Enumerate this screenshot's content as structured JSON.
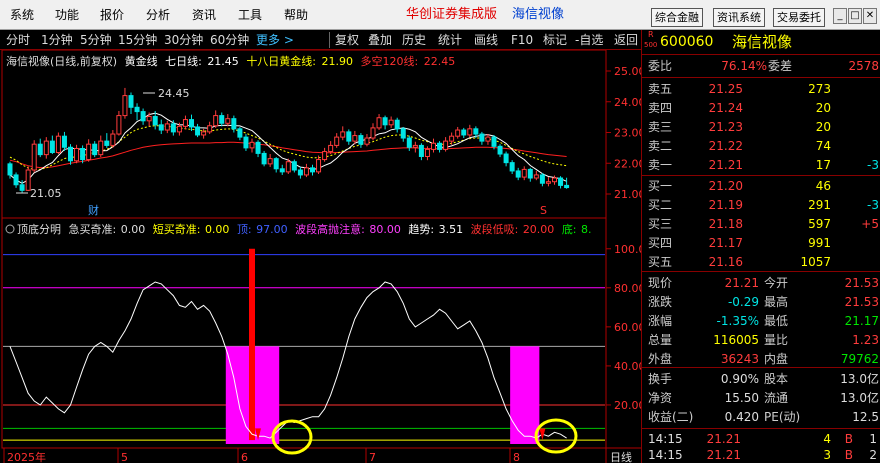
{
  "menu": [
    "系统",
    "功能",
    "报价",
    "分析",
    "资讯",
    "工具",
    "帮助"
  ],
  "brand": {
    "app": "华创证券集成版",
    "stock": "海信视像"
  },
  "top_buttons": [
    "综合金融",
    "资讯系统",
    "交易委托"
  ],
  "window_controls": [
    "_",
    "□",
    "✕"
  ],
  "toolbar_left": [
    "分时",
    "1分钟",
    "5分钟",
    "15分钟",
    "30分钟",
    "60分钟",
    "更多 >"
  ],
  "toolbar_right": [
    "复权",
    "叠加",
    "历史",
    "统计",
    "画线",
    "F10",
    "标记",
    "-自选",
    "返回"
  ],
  "main_legend": {
    "title": "海信视像(日线,前复权)",
    "ma1_label": "黄金线",
    "ma2_label": "七日线:",
    "ma2_val": "21.45",
    "ma3_label": "十八日黄金线:",
    "ma3_val": "21.90",
    "ma4_label": "多空120线:",
    "ma4_val": "22.45"
  },
  "sub_legend": {
    "name": "顶底分明",
    "f1_label": "急买奇准:",
    "f1_val": "0.00",
    "f2_label": "短买奇准:",
    "f2_val": "0.00",
    "f3_label": "顶:",
    "f3_val": "97.00",
    "f4_label": "波段高抛注意:",
    "f4_val": "80.00",
    "f5_label": "趋势:",
    "f5_val": "3.51",
    "f6_label": "波段低吸:",
    "f6_val": "20.00",
    "f7_label": "底:",
    "f7_val": "8."
  },
  "annotations": {
    "high": "24.45",
    "low": "21.05",
    "cai": "财",
    "s_mark": "S"
  },
  "main_axis": [
    "25.00",
    "24.00",
    "23.00",
    "22.00",
    "21.00"
  ],
  "sub_axis": [
    "100.0",
    "80.00",
    "60.00",
    "40.00",
    "20.00"
  ],
  "date_axis": [
    "2025年",
    "5",
    "6",
    "7",
    "8"
  ],
  "period": "日线",
  "chart_data": {
    "type": "candlestick",
    "price_axis": {
      "ylim": [
        20.5,
        25.2
      ],
      "ticks": [
        25,
        24,
        23,
        22,
        21
      ]
    },
    "candles": [
      [
        21.98,
        21.62,
        22.05,
        21.5
      ],
      [
        21.62,
        21.3,
        21.7,
        21.2
      ],
      [
        21.3,
        21.12,
        21.45,
        21.05
      ],
      [
        21.12,
        21.78,
        21.9,
        21.1
      ],
      [
        21.78,
        22.62,
        22.75,
        21.7
      ],
      [
        22.62,
        22.28,
        22.8,
        22.2
      ],
      [
        22.28,
        22.72,
        22.85,
        22.15
      ],
      [
        22.72,
        22.35,
        22.9,
        22.3
      ],
      [
        22.35,
        22.88,
        23.0,
        22.3
      ],
      [
        22.88,
        22.52,
        23.02,
        22.4
      ],
      [
        22.52,
        22.08,
        22.62,
        21.95
      ],
      [
        22.08,
        22.48,
        22.6,
        22.0
      ],
      [
        22.48,
        22.12,
        22.58,
        22.0
      ],
      [
        22.12,
        22.62,
        22.78,
        22.05
      ],
      [
        22.62,
        22.28,
        22.72,
        22.2
      ],
      [
        22.28,
        22.72,
        22.9,
        22.2
      ],
      [
        22.72,
        22.58,
        22.98,
        22.5
      ],
      [
        22.58,
        22.95,
        23.08,
        22.5
      ],
      [
        22.95,
        23.55,
        23.7,
        22.9
      ],
      [
        23.55,
        24.2,
        24.45,
        23.45
      ],
      [
        24.2,
        23.82,
        24.3,
        23.6
      ],
      [
        23.82,
        23.68,
        23.95,
        23.4
      ],
      [
        23.68,
        23.38,
        23.78,
        23.25
      ],
      [
        23.38,
        23.52,
        23.65,
        23.2
      ],
      [
        23.52,
        23.25,
        23.7,
        23.1
      ],
      [
        23.25,
        23.08,
        23.42,
        22.95
      ],
      [
        23.08,
        23.28,
        23.38,
        22.98
      ],
      [
        23.28,
        23.02,
        23.4,
        22.9
      ],
      [
        23.02,
        23.2,
        23.32,
        22.9
      ],
      [
        23.2,
        23.42,
        23.55,
        23.1
      ],
      [
        23.42,
        23.18,
        23.58,
        23.05
      ],
      [
        23.18,
        22.92,
        23.28,
        22.85
      ],
      [
        22.92,
        23.02,
        23.12,
        22.8
      ],
      [
        23.02,
        23.22,
        23.35,
        22.95
      ],
      [
        23.22,
        23.55,
        23.72,
        23.15
      ],
      [
        23.55,
        23.3,
        23.65,
        23.2
      ],
      [
        23.3,
        23.45,
        23.6,
        23.2
      ],
      [
        23.45,
        23.12,
        23.55,
        23.0
      ],
      [
        23.12,
        22.85,
        23.18,
        22.75
      ],
      [
        22.85,
        22.5,
        22.95,
        22.4
      ],
      [
        22.5,
        22.68,
        22.8,
        22.35
      ],
      [
        22.68,
        22.32,
        22.75,
        22.2
      ],
      [
        22.32,
        21.98,
        22.4,
        21.9
      ],
      [
        21.98,
        22.15,
        22.3,
        21.88
      ],
      [
        22.15,
        21.82,
        22.2,
        21.7
      ],
      [
        21.82,
        21.72,
        21.95,
        21.62
      ],
      [
        21.72,
        22.05,
        22.15,
        21.65
      ],
      [
        22.05,
        21.78,
        22.12,
        21.7
      ],
      [
        21.78,
        21.62,
        21.88,
        21.5
      ],
      [
        21.62,
        21.85,
        21.98,
        21.55
      ],
      [
        21.85,
        21.72,
        21.95,
        21.6
      ],
      [
        21.72,
        22.12,
        22.25,
        21.65
      ],
      [
        22.12,
        22.38,
        22.5,
        22.05
      ],
      [
        22.38,
        22.58,
        22.72,
        22.3
      ],
      [
        22.58,
        22.85,
        22.98,
        22.5
      ],
      [
        22.85,
        23.02,
        23.2,
        22.75
      ],
      [
        23.02,
        22.72,
        23.1,
        22.6
      ],
      [
        22.72,
        22.9,
        23.05,
        22.62
      ],
      [
        22.9,
        22.62,
        22.98,
        22.5
      ],
      [
        22.62,
        22.82,
        22.95,
        22.55
      ],
      [
        22.82,
        23.15,
        23.3,
        22.75
      ],
      [
        23.15,
        23.48,
        23.6,
        23.08
      ],
      [
        23.48,
        23.25,
        23.55,
        23.1
      ],
      [
        23.25,
        23.4,
        23.52,
        23.15
      ],
      [
        23.4,
        23.12,
        23.48,
        23.0
      ],
      [
        23.12,
        22.82,
        23.18,
        22.7
      ],
      [
        22.82,
        22.52,
        22.9,
        22.4
      ],
      [
        22.52,
        22.58,
        22.7,
        22.35
      ],
      [
        22.58,
        22.22,
        22.65,
        22.1
      ],
      [
        22.22,
        22.45,
        22.55,
        22.1
      ],
      [
        22.45,
        22.65,
        22.8,
        22.35
      ],
      [
        22.65,
        22.45,
        22.72,
        22.35
      ],
      [
        22.45,
        22.72,
        22.85,
        22.38
      ],
      [
        22.72,
        22.88,
        23.0,
        22.6
      ],
      [
        22.88,
        23.08,
        23.18,
        22.8
      ],
      [
        23.08,
        22.92,
        23.15,
        22.82
      ],
      [
        22.92,
        23.12,
        23.25,
        22.85
      ],
      [
        23.12,
        22.95,
        23.2,
        22.82
      ],
      [
        22.95,
        22.72,
        23.02,
        22.6
      ],
      [
        22.72,
        22.85,
        22.95,
        22.6
      ],
      [
        22.85,
        22.55,
        22.92,
        22.45
      ],
      [
        22.55,
        22.3,
        22.62,
        22.2
      ],
      [
        22.3,
        22.02,
        22.38,
        21.9
      ],
      [
        22.02,
        21.75,
        22.1,
        21.65
      ],
      [
        21.75,
        21.55,
        21.85,
        21.45
      ],
      [
        21.55,
        21.8,
        21.9,
        21.45
      ],
      [
        21.8,
        21.52,
        21.85,
        21.4
      ],
      [
        21.52,
        21.62,
        21.75,
        21.45
      ],
      [
        21.62,
        21.35,
        21.68,
        21.25
      ],
      [
        21.35,
        21.4,
        21.55,
        21.25
      ],
      [
        21.4,
        21.52,
        21.6,
        21.3
      ],
      [
        21.52,
        21.28,
        21.58,
        21.18
      ],
      [
        21.28,
        21.21,
        21.53,
        21.17
      ]
    ],
    "ma_yellow": [
      22.2,
      22.1,
      21.95,
      21.85,
      21.8,
      21.8,
      21.85,
      21.95,
      22.05,
      22.15,
      22.2,
      22.2,
      22.25,
      22.3,
      22.35,
      22.4,
      22.45,
      22.55,
      22.7,
      22.85,
      23.0,
      23.1,
      23.15,
      23.2,
      23.22,
      23.22,
      23.2,
      23.18,
      23.15,
      23.12,
      23.1,
      23.08,
      23.05,
      23.05,
      23.08,
      23.1,
      23.12,
      23.1,
      23.05,
      22.98,
      22.9,
      22.82,
      22.72,
      22.62,
      22.52,
      22.42,
      22.35,
      22.3,
      22.25,
      22.2,
      22.18,
      22.18,
      22.2,
      22.25,
      22.32,
      22.4,
      22.48,
      22.55,
      22.6,
      22.65,
      22.7,
      22.78,
      22.85,
      22.9,
      22.92,
      22.92,
      22.88,
      22.82,
      22.75,
      22.7,
      22.65,
      22.62,
      22.62,
      22.65,
      22.7,
      22.75,
      22.8,
      22.82,
      22.82,
      22.8,
      22.75,
      22.68,
      22.58,
      22.48,
      22.38,
      22.3,
      22.22,
      22.15,
      22.08,
      22.02,
      21.98,
      21.95,
      21.92
    ],
    "ma_red": [
      22.1,
      22.05,
      21.98,
      21.92,
      21.88,
      21.86,
      21.86,
      21.88,
      21.92,
      21.96,
      22.0,
      22.03,
      22.06,
      22.1,
      22.13,
      22.17,
      22.2,
      22.24,
      22.3,
      22.36,
      22.42,
      22.47,
      22.52,
      22.55,
      22.58,
      22.6,
      22.62,
      22.63,
      22.64,
      22.65,
      22.66,
      22.66,
      22.66,
      22.66,
      22.67,
      22.67,
      22.68,
      22.68,
      22.67,
      22.66,
      22.64,
      22.62,
      22.6,
      22.57,
      22.54,
      22.5,
      22.47,
      22.44,
      22.41,
      22.38,
      22.36,
      22.35,
      22.34,
      22.34,
      22.35,
      22.36,
      22.37,
      22.38,
      22.39,
      22.4,
      22.42,
      22.44,
      22.46,
      22.48,
      22.49,
      22.5,
      22.5,
      22.5,
      22.49,
      22.48,
      22.47,
      22.47,
      22.47,
      22.48,
      22.49,
      22.5,
      22.51,
      22.52,
      22.52,
      22.52,
      22.51,
      22.5,
      22.48,
      22.46,
      22.43,
      22.4,
      22.37,
      22.34,
      22.31,
      22.28,
      22.26,
      22.24,
      22.22
    ],
    "indicator_axis": {
      "ylim": [
        0,
        105
      ],
      "ticks": [
        100,
        80,
        60,
        40,
        20
      ]
    },
    "indicator_levels": {
      "top": 97,
      "high": 80,
      "mid": 50,
      "low": 20,
      "bottom": 8
    },
    "indicator_line": [
      50,
      42,
      34,
      26,
      22,
      20,
      24,
      21,
      18,
      16,
      20,
      29,
      38,
      46,
      50,
      52,
      50,
      47,
      53,
      58,
      64,
      72,
      79,
      81,
      83,
      82,
      79,
      76,
      71,
      70,
      73,
      69,
      71,
      68,
      62,
      55,
      46,
      34,
      18,
      9,
      5,
      4,
      4,
      3,
      6,
      9,
      12,
      11,
      12,
      13,
      14,
      14,
      18,
      25,
      34,
      44,
      55,
      64,
      70,
      75,
      78,
      80,
      83,
      82,
      78,
      72,
      64,
      60,
      62,
      64,
      66,
      69,
      67,
      63,
      59,
      61,
      63,
      58,
      52,
      44,
      34,
      26,
      18,
      12,
      7,
      4,
      4,
      3,
      5,
      4,
      6,
      5,
      3
    ],
    "pink_bars": [
      {
        "from": 36,
        "to": 44,
        "value": 50
      },
      {
        "from": 83,
        "to": 87,
        "value": 50
      }
    ],
    "red_spike": {
      "index": 40,
      "value": 100
    }
  },
  "quote": {
    "code": "600060",
    "name": "海信视像",
    "r_label": "R",
    "r_sub": "500",
    "weibi": {
      "label": "委比",
      "value": "76.14%"
    },
    "weicha": {
      "label": "委差",
      "value": "2578"
    },
    "sells": [
      {
        "label": "卖五",
        "price": "21.25",
        "vol": "273",
        "chg": ""
      },
      {
        "label": "卖四",
        "price": "21.24",
        "vol": "20",
        "chg": ""
      },
      {
        "label": "卖三",
        "price": "21.23",
        "vol": "20",
        "chg": ""
      },
      {
        "label": "卖二",
        "price": "21.22",
        "vol": "74",
        "chg": ""
      },
      {
        "label": "卖一",
        "price": "21.21",
        "vol": "17",
        "chg": "-3"
      }
    ],
    "buys": [
      {
        "label": "买一",
        "price": "21.20",
        "vol": "46",
        "chg": ""
      },
      {
        "label": "买二",
        "price": "21.19",
        "vol": "291",
        "chg": "-3"
      },
      {
        "label": "买三",
        "price": "21.18",
        "vol": "597",
        "chg": "+5"
      },
      {
        "label": "买四",
        "price": "21.17",
        "vol": "991",
        "chg": ""
      },
      {
        "label": "买五",
        "price": "21.16",
        "vol": "1057",
        "chg": ""
      }
    ],
    "stats": [
      {
        "l1": "现价",
        "v1": "21.21",
        "l2": "今开",
        "v2": "21.53"
      },
      {
        "l1": "涨跌",
        "v1": "-0.29",
        "l2": "最高",
        "v2": "21.53"
      },
      {
        "l1": "涨幅",
        "v1": "-1.35%",
        "l2": "最低",
        "v2": "21.17"
      },
      {
        "l1": "总量",
        "v1": "116005",
        "l2": "量比",
        "v2": "1.23"
      },
      {
        "l1": "外盘",
        "v1": "36243",
        "l2": "内盘",
        "v2": "79762"
      }
    ],
    "stats2": [
      {
        "l1": "换手",
        "v1": "0.90%",
        "l2": "股本",
        "v2": "13.0亿"
      },
      {
        "l1": "净资",
        "v1": "15.50",
        "l2": "流通",
        "v2": "13.0亿"
      },
      {
        "l1": "收益(二)",
        "v1": "0.420",
        "l2": "PE(动)",
        "v2": "12.5"
      }
    ],
    "ticks": [
      {
        "time": "14:15",
        "price": "21.21",
        "vol": "4",
        "side": "B",
        "n": "1"
      },
      {
        "time": "14:15",
        "price": "21.21",
        "vol": "3",
        "side": "B",
        "n": "2"
      }
    ]
  },
  "colors": {
    "up": "#ff3c3c",
    "down": "#00e5e5",
    "yellow": "#ffff00",
    "green": "#00e600",
    "magenta": "#ff00ff",
    "red": "#ff0000",
    "axis_red": "#b00000"
  }
}
